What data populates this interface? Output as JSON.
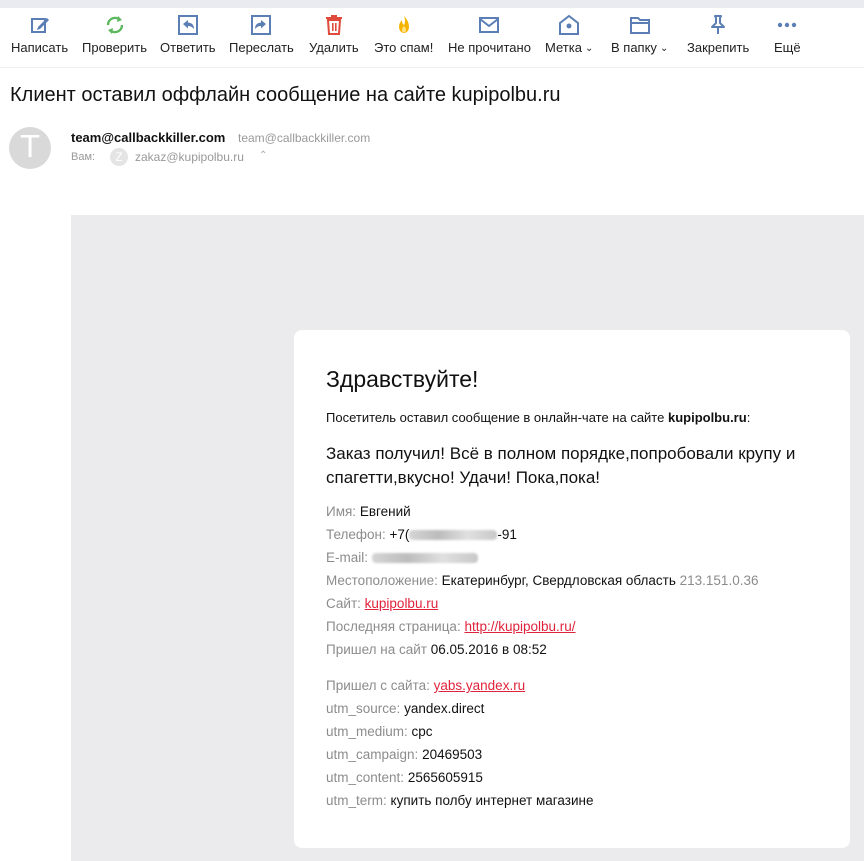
{
  "toolbar": {
    "items": [
      {
        "label": "Написать",
        "icon": "compose-icon"
      },
      {
        "label": "Проверить",
        "icon": "refresh-icon"
      },
      {
        "label": "Ответить",
        "icon": "reply-icon"
      },
      {
        "label": "Переслать",
        "icon": "forward-icon"
      },
      {
        "label": "Удалить",
        "icon": "trash-icon"
      },
      {
        "label": "Это спам!",
        "icon": "spam-fire-icon"
      },
      {
        "label": "Не прочитано",
        "icon": "envelope-icon"
      },
      {
        "label": "Метка",
        "icon": "tag-icon",
        "dropdown": true
      },
      {
        "label": "В папку",
        "icon": "folder-icon",
        "dropdown": true
      },
      {
        "label": "Закрепить",
        "icon": "pin-icon"
      },
      {
        "label": "Ещё",
        "icon": "more-dots-icon"
      }
    ],
    "colors": {
      "default": "#5b7fb5",
      "refresh": "#5cb85c",
      "trash": "#e04a3c",
      "spam": "#f5b400"
    }
  },
  "email": {
    "subject": "Клиент оставил оффлайн сообщение на сайте kupipolbu.ru",
    "sender_initial": "T",
    "sender_name": "team@callbackkiller.com",
    "sender_address": "team@callbackkiller.com",
    "to_label": "Вам:",
    "to_initial": "Z",
    "to_address": "zakaz@kupipolbu.ru"
  },
  "body": {
    "greeting": "Здравствуйте!",
    "intro_text": "Посетитель оставил сообщение в онлайн-чате на сайте ",
    "intro_site": "kupipolbu.ru",
    "intro_colon": ":",
    "message": "Заказ получил! Всё в полном порядке,попробовали крупу и спагетти,вкусно! Удачи! Пока,пока!",
    "fields": {
      "name": {
        "key": "Имя:",
        "value": "Евгений"
      },
      "phone": {
        "key": "Телефон:",
        "prefix": "+7(",
        "suffix": "-91"
      },
      "email": {
        "key": "E-mail:"
      },
      "location": {
        "key": "Местоположение:",
        "value": "Екатеринбург, Свердловская область",
        "ip": "213.151.0.36"
      },
      "site": {
        "key": "Сайт:",
        "value": "kupipolbu.ru"
      },
      "last_page": {
        "key": "Последняя страница:",
        "value": "http://kupipolbu.ru/"
      },
      "arrived": {
        "key": "Пришел на сайт",
        "value": "06.05.2016 в 08:52"
      },
      "referrer": {
        "key": "Пришел с сайта:",
        "value": "yabs.yandex.ru"
      },
      "utm_source": {
        "key": "utm_source:",
        "value": "yandex.direct"
      },
      "utm_medium": {
        "key": "utm_medium:",
        "value": "cpc"
      },
      "utm_campaign": {
        "key": "utm_campaign:",
        "value": "20469503"
      },
      "utm_content": {
        "key": "utm_content:",
        "value": "2565605915"
      },
      "utm_term": {
        "key": "utm_term:",
        "value": "купить полбу интернет магазине"
      }
    },
    "link_color": "#e0233c"
  }
}
